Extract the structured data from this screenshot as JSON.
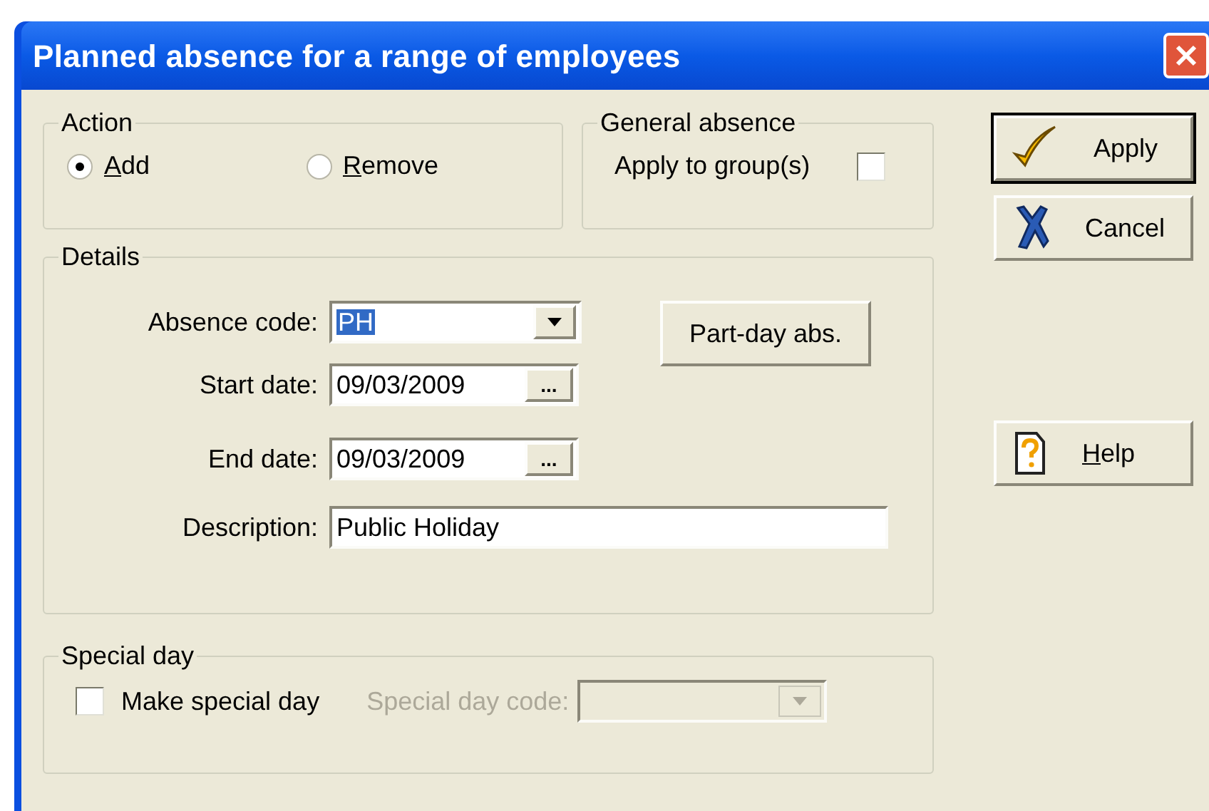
{
  "window": {
    "title": "Planned absence for a range of employees"
  },
  "action": {
    "title": "Action",
    "options": [
      {
        "label": "Add",
        "selected": true
      },
      {
        "label": "Remove",
        "selected": false
      }
    ]
  },
  "general_absence": {
    "title": "General absence",
    "apply_to_groups": {
      "label": "Apply to group(s)",
      "checked": false
    }
  },
  "details": {
    "title": "Details",
    "absence_code": {
      "label": "Absence code:",
      "value": "PH",
      "highlighted": true
    },
    "start_date": {
      "label": "Start date:",
      "value": "09/03/2009",
      "button": "..."
    },
    "end_date": {
      "label": "End date:",
      "value": "09/03/2009",
      "button": "..."
    },
    "description": {
      "label": "Description:",
      "value": "Public Holiday"
    },
    "part_day_button": "Part-day abs."
  },
  "special_day": {
    "title": "Special day",
    "make_special_day": {
      "label": "Make special day",
      "checked": false
    },
    "special_day_code": {
      "label": "Special day code:",
      "disabled": true
    }
  },
  "buttons": [
    {
      "kind": "apply",
      "label": "Apply",
      "default": true
    },
    {
      "kind": "cancel",
      "label": "Cancel",
      "default": false
    },
    {
      "kind": "help",
      "label": "Help",
      "default": false
    }
  ]
}
